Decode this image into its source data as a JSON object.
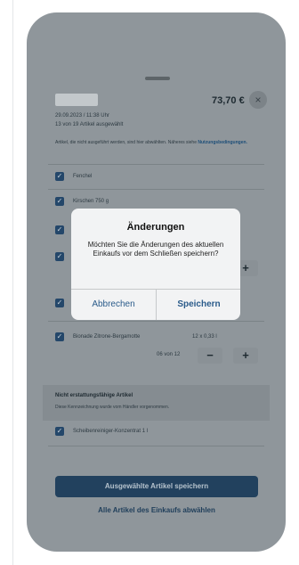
{
  "sheet": {
    "amount": "73,70 €",
    "close_icon": "×",
    "meta_line1": "29.09.2023 / 11:38 Uhr",
    "meta_line2": "13 von 19 Artikel ausgewählt",
    "notice_text": "Artikel, die nicht ausgeführt werden, sind hier abwählten. Näheres siehe",
    "notice_link": "Nutzungsbedingungen.",
    "items": [
      {
        "label": "Fenchel"
      },
      {
        "label": "Kirschen 750 g"
      },
      {
        "label": "Bionade Zitrone-Bergamotte",
        "qty_info": "12 x 0,33 l",
        "counter": "06 von 12"
      }
    ],
    "stepper_minus": "−",
    "stepper_plus": "+",
    "checkbox_glyph": "✓",
    "nonrefundable": {
      "title": "Nicht erstattungsfähige Artikel",
      "subtitle": "Diese Kennzeichnung wurde vom Händler vorgenommen.",
      "items": [
        {
          "label": "Scheibenreiniger-Konzentrat 1 l"
        }
      ]
    },
    "save_selected": "Ausgewählte Artikel speichern",
    "select_all": "Alle Artikel des Einkaufs abwählen"
  },
  "dialog": {
    "title": "Änderungen",
    "message": "Möchten Sie die Änderungen des aktuellen Einkaufs vor dem Schließen speichern?",
    "cancel": "Abbrechen",
    "save": "Speichern"
  },
  "colors": {
    "overlay_grey": "#8f969b",
    "brand_dark_blue": "#22415e",
    "dialog_link_blue": "#2a5b8a"
  }
}
